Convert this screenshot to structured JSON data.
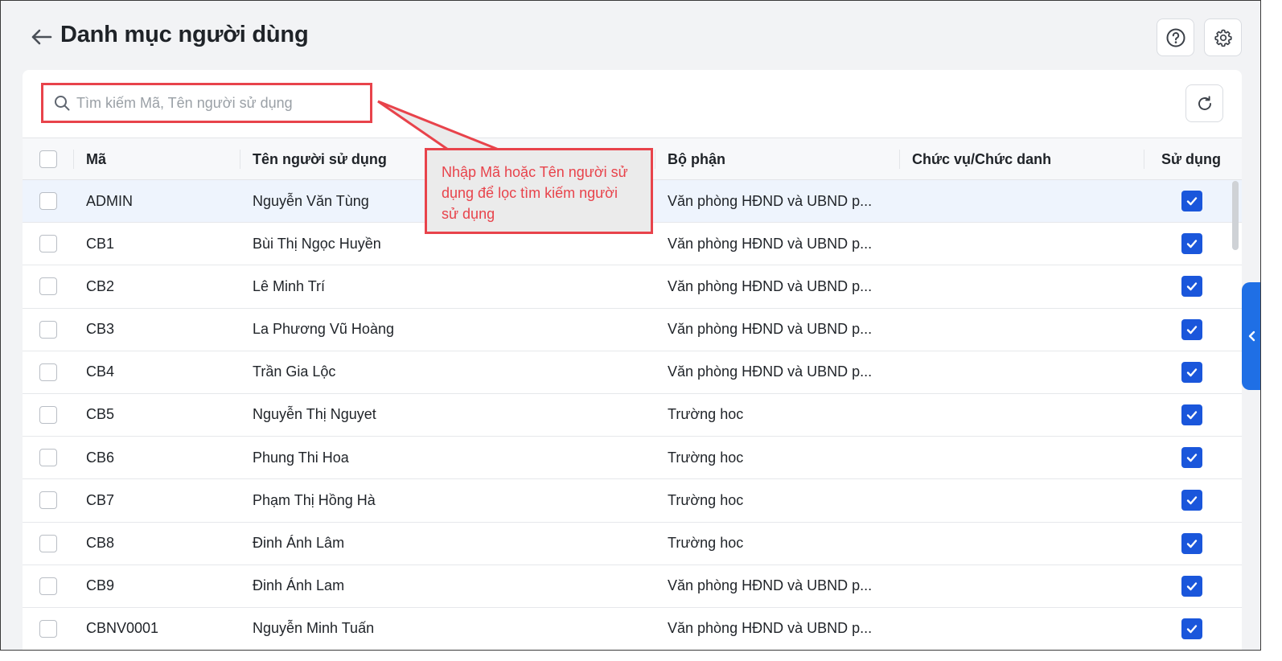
{
  "header": {
    "title": "Danh mục người dùng"
  },
  "search": {
    "placeholder": "Tìm kiếm Mã, Tên người sử dụng"
  },
  "table": {
    "columns": {
      "code": "Mã",
      "name": "Tên người sử dụng",
      "department": "Bộ phận",
      "position": "Chức vụ/Chức danh",
      "in_use": "Sử dụng"
    },
    "rows": [
      {
        "code": "ADMIN",
        "name": "Nguyễn Văn Tùng",
        "department": "Văn phòng HĐND và UBND p...",
        "position": "",
        "in_use": true,
        "selected": true
      },
      {
        "code": "CB1",
        "name": "Bùi Thị Ngọc Huyền",
        "department": "Văn phòng HĐND và UBND p...",
        "position": "",
        "in_use": true
      },
      {
        "code": "CB2",
        "name": "Lê Minh Trí",
        "department": "Văn phòng HĐND và UBND p...",
        "position": "",
        "in_use": true
      },
      {
        "code": "CB3",
        "name": "La Phương Vũ Hoàng",
        "department": "Văn phòng HĐND và UBND p...",
        "position": "",
        "in_use": true
      },
      {
        "code": "CB4",
        "name": "Trần Gia Lộc",
        "department": "Văn phòng HĐND và UBND p...",
        "position": "",
        "in_use": true
      },
      {
        "code": "CB5",
        "name": "Nguyễn Thị Nguyet",
        "department": "Trường hoc",
        "position": "",
        "in_use": true
      },
      {
        "code": "CB6",
        "name": "Phung Thi Hoa",
        "department": "Trường hoc",
        "position": "",
        "in_use": true
      },
      {
        "code": "CB7",
        "name": "Phạm Thị Hồng Hà",
        "department": "Trường hoc",
        "position": "",
        "in_use": true
      },
      {
        "code": "CB8",
        "name": "Đinh Ánh Lâm",
        "department": "Trường hoc",
        "position": "",
        "in_use": true
      },
      {
        "code": "CB9",
        "name": "Đinh Ánh Lam",
        "department": "Văn phòng HĐND và UBND p...",
        "position": "",
        "in_use": true
      },
      {
        "code": "CBNV0001",
        "name": "Nguyễn Minh Tuấn",
        "department": "Văn phòng HĐND và UBND p...",
        "position": "",
        "in_use": true
      }
    ]
  },
  "callout": {
    "text": "Nhập Mã hoặc Tên người sử dụng để lọc tìm kiếm người sử dụng"
  },
  "icons": {
    "back": "arrow-left-icon",
    "help": "question-circle-icon",
    "settings": "gear-icon",
    "search": "search-icon",
    "refresh": "refresh-icon",
    "side_tab": "chevron-left-icon",
    "check": "checkmark-icon"
  },
  "colors": {
    "accent": "#1a56db",
    "side_tab": "#1f6fe5",
    "annotation": "#e8434b",
    "selected_row": "#eef4fd"
  }
}
